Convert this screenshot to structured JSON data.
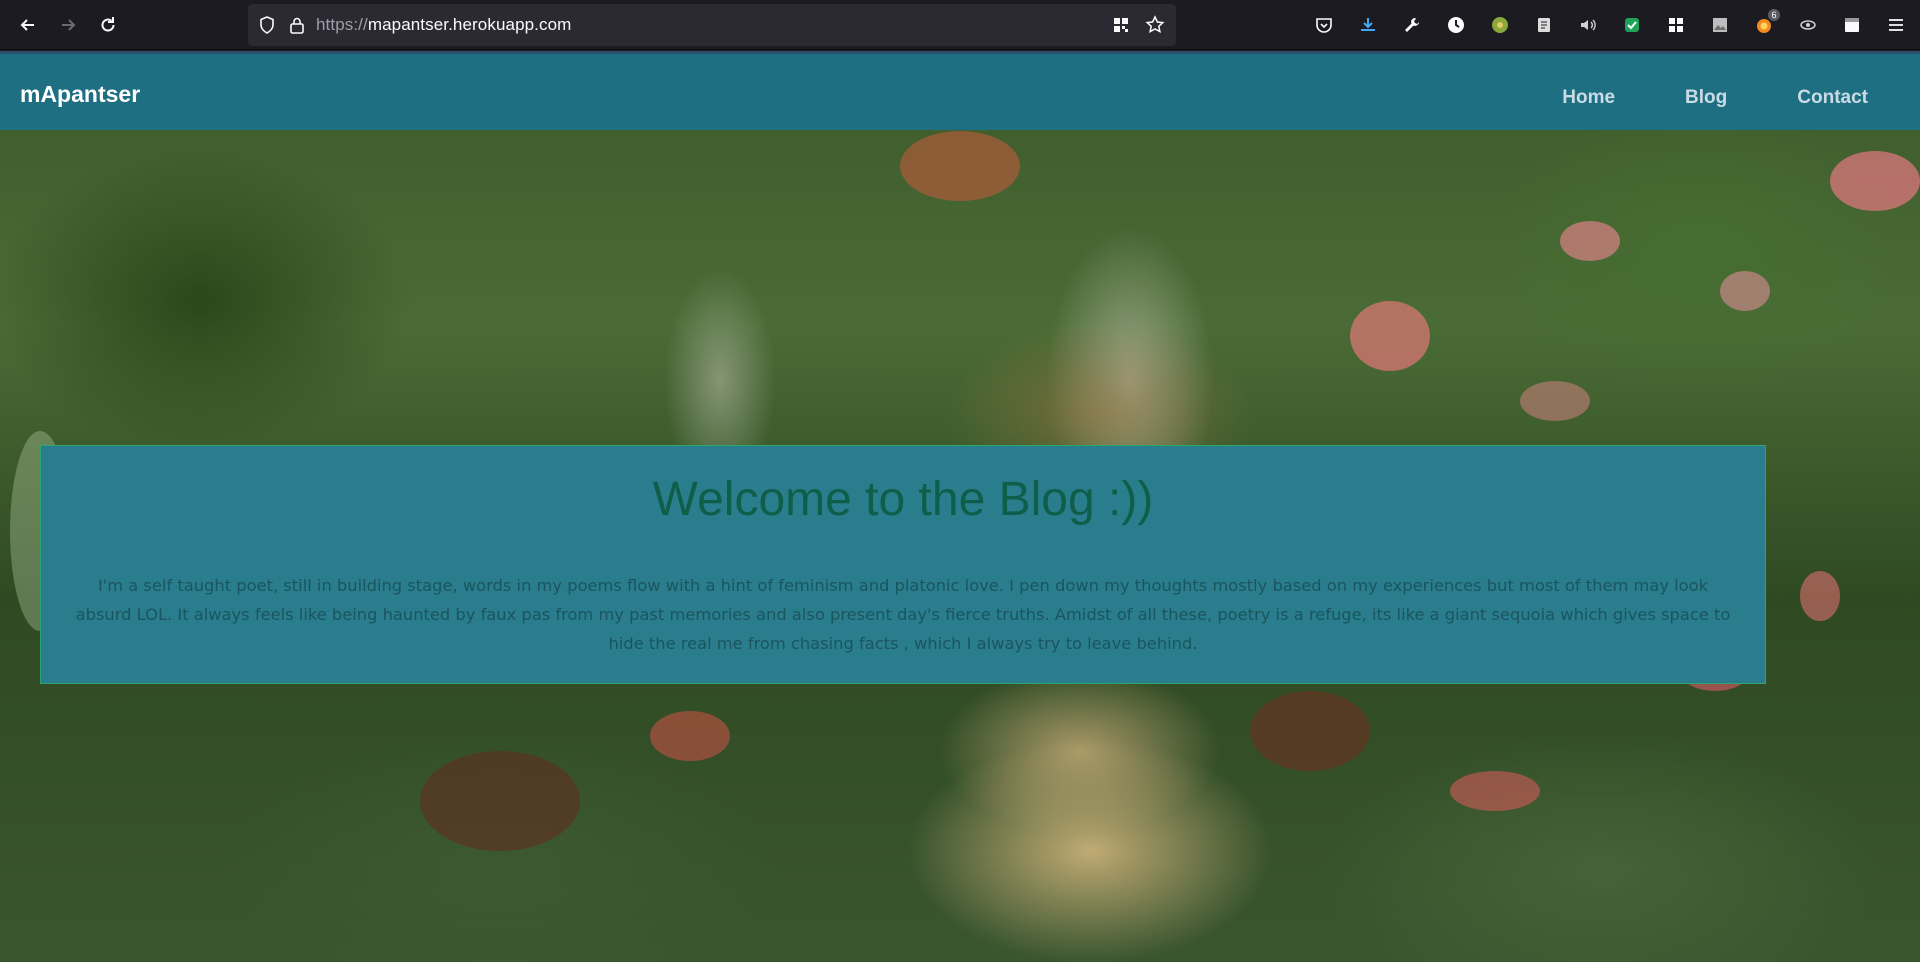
{
  "browser": {
    "url_protocol": "https://",
    "url_host": "mapantser.herokuapp.com",
    "extension_badge": "6"
  },
  "site": {
    "brand": "mApantser",
    "nav": {
      "home": "Home",
      "blog": "Blog",
      "contact": "Contact"
    },
    "colors": {
      "navbar": "#1f6f83",
      "box": "#2a7d8c",
      "title": "#0f5e4a"
    }
  },
  "hero": {
    "title": "Welcome to the Blog :))",
    "text": "I'm a self taught poet, still in building stage, words in my poems flow with a hint of feminism and platonic love. I pen down my thoughts mostly based on my experiences but most of them may look absurd LOL. It always feels like being haunted by faux pas from my past memories and also present day's fierce truths. Amidst of all these, poetry is a refuge, its like a giant sequoia which gives space to hide the real me from chasing facts , which I always try to leave behind."
  }
}
